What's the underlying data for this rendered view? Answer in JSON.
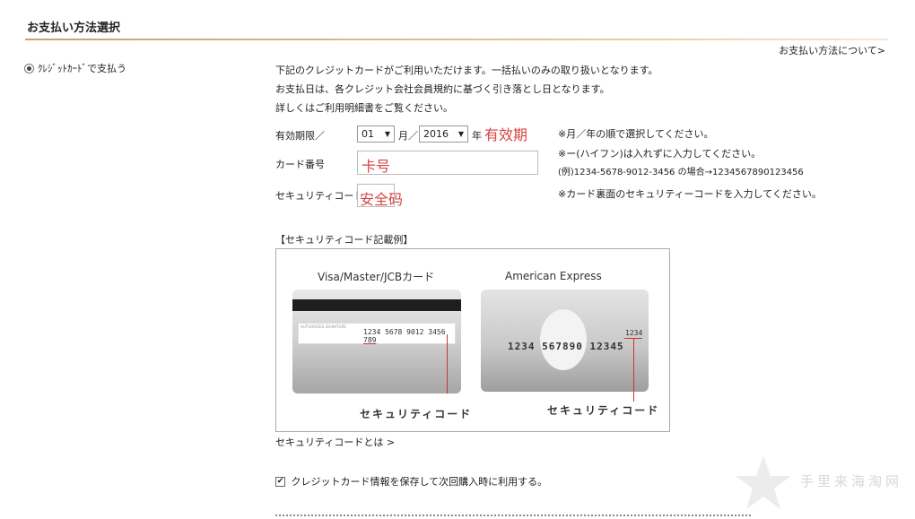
{
  "section_title": "お支払い方法選択",
  "about_link": "お支払い方法について>",
  "payment_option": {
    "label": "ｸﾚｼﾞｯﾄｶｰﾄﾞで支払う",
    "selected": true
  },
  "description": [
    "下記のクレジットカードがご利用いただけます。一括払いのみの取り扱いとなります。",
    "お支払日は、各クレジット会社会員規約に基づく引き落とし日となります。",
    "詳しくはご利用明細書をご覧ください。"
  ],
  "expiry": {
    "label": "有効期限／",
    "month": "01",
    "month_unit": "月／",
    "year": "2016",
    "year_unit": "年",
    "annotation": "有效期",
    "note": "※月／年の順で選択してください。"
  },
  "card_number": {
    "label": "カード番号",
    "annotation": "卡号",
    "note1": "※ー(ハイフン)は入れずに入力してください。",
    "note2": "(例)1234-5678-9012-3456 の場合→1234567890123456"
  },
  "security_code": {
    "label": "セキュリティコード",
    "annotation": "安全码",
    "note": "※カード裏面のセキュリティーコードを入力してください。"
  },
  "example": {
    "heading": "【セキュリティコード記載例】",
    "visa_caption": "Visa/Master/JCBカード",
    "amex_caption": "American Express",
    "visa_number": "1234 5678 9012 3456",
    "visa_code": "789",
    "amex_number": "1234 567890 12345",
    "amex_code": "1234",
    "code_label": "セキュリティコード"
  },
  "security_link": "セキュリティコードとは >",
  "save_card": {
    "label": "クレジットカード情報を保存して次回購入時に利用する。",
    "checked": true
  },
  "watermark_text": "手里来海淘网",
  "colors": {
    "accent_rule": "#d9b27a",
    "annotation_red": "#d64545"
  }
}
